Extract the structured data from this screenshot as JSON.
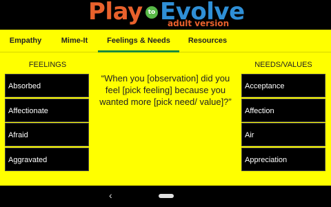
{
  "header": {
    "logo_play": "Play",
    "logo_to": "to",
    "logo_evolve": "Evolve",
    "logo_subtitle": "adult version"
  },
  "tabs": [
    {
      "label": "Empathy"
    },
    {
      "label": "Mime-It"
    },
    {
      "label": "Feelings & Needs"
    },
    {
      "label": "Resources"
    }
  ],
  "feelings": {
    "heading": "FEELINGS",
    "items": [
      "Absorbed",
      "Affectionate",
      "Afraid",
      "Aggravated"
    ]
  },
  "needs": {
    "heading": "NEEDS/VALUES",
    "items": [
      "Acceptance",
      "Affection",
      "Air",
      "Appreciation"
    ]
  },
  "prompt": "“When you [observation] did you feel [pick feeling] because you wanted more [pick need/ value]?”",
  "colors": {
    "app_background": "#ffff00",
    "active_tab": "#1b8a3e",
    "logo_orange": "#e8612c",
    "logo_blue": "#2f8fd6",
    "logo_green": "#58b947"
  }
}
